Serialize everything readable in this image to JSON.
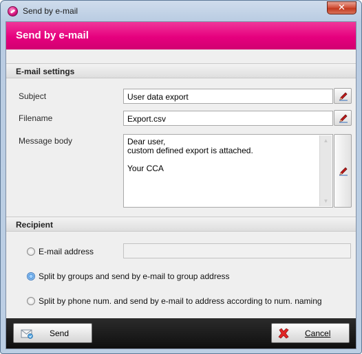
{
  "window": {
    "title": "Send by e-mail",
    "close_glyph": "✕"
  },
  "banner": {
    "title": "Send by e-mail"
  },
  "email_settings": {
    "header": "E-mail settings",
    "subject": {
      "label": "Subject",
      "value": "User data export"
    },
    "filename": {
      "label": "Filename",
      "value": "Export.csv"
    },
    "message_body": {
      "label": "Message body",
      "lines": [
        "Dear user,",
        "custom defined export is attached.",
        "",
        "Your CCA"
      ]
    }
  },
  "recipient": {
    "header": "Recipient",
    "options": [
      {
        "label": "E-mail address",
        "checked": false
      },
      {
        "label": "Split by groups and send by e-mail to group address",
        "checked": true
      },
      {
        "label": "Split by phone num. and send by e-mail to address according to num. naming",
        "checked": false
      }
    ],
    "email_address_value": ""
  },
  "footer": {
    "send_label": "Send",
    "cancel_label": "Cancel"
  },
  "colors": {
    "accent": "#e6007e",
    "footer_bg": "#1a1a1a",
    "titlebar": "#c5d6ea"
  },
  "icons": {
    "app": "app-logo-icon",
    "edit": "pencil-icon",
    "send": "send-mail-icon",
    "cancel": "red-x-icon"
  }
}
